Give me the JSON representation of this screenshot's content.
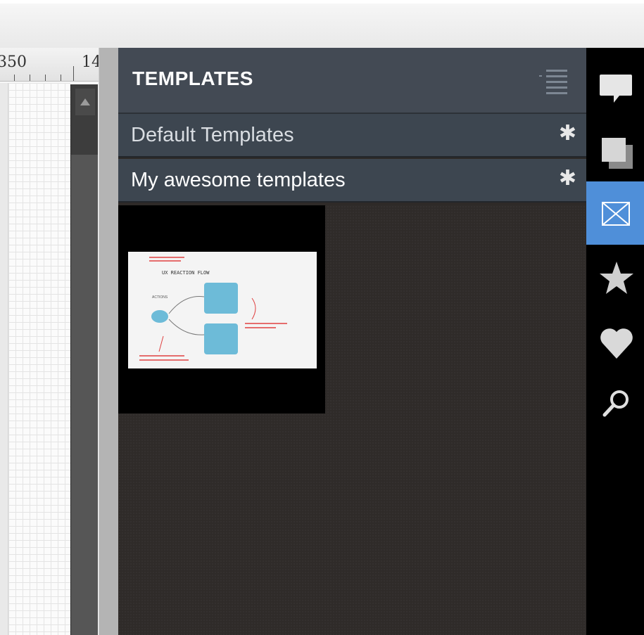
{
  "ruler": {
    "labels": [
      "350",
      "14"
    ]
  },
  "panel": {
    "title": "TEMPLATES",
    "sections": [
      {
        "label": "Default Templates",
        "marker": "✱"
      },
      {
        "label": "My awesome templates",
        "marker": "✱"
      }
    ]
  },
  "template_thumbnail": {
    "title": "UX REACTION FLOW",
    "box_color": "#6dbbd8",
    "note_color": "#e04040"
  },
  "iconbar": {
    "items": [
      "comment-icon",
      "layers-icon",
      "templates-icon",
      "star-icon",
      "heart-icon",
      "search-icon"
    ],
    "active": "templates-icon",
    "active_color": "#4f8fd9"
  },
  "colors": {
    "panel_header": "#434a54",
    "section_row": "#3d4650",
    "panel_bg": "#2e2a28"
  }
}
